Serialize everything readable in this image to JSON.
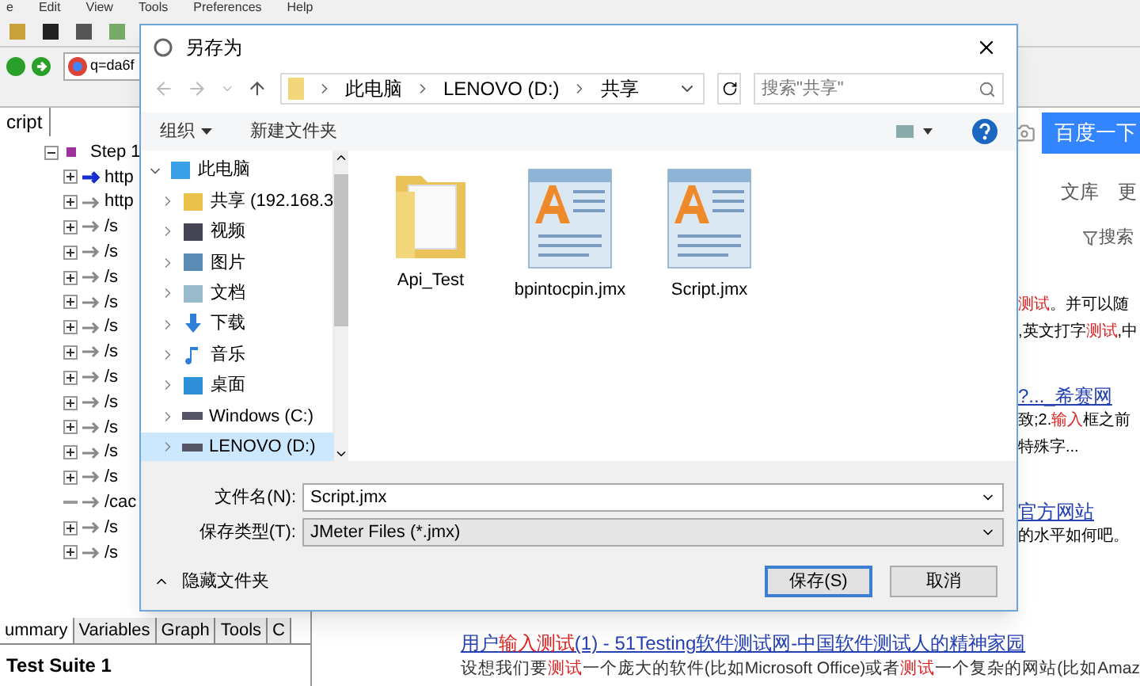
{
  "app": {
    "menu": [
      "e",
      "Edit",
      "View",
      "Tools",
      "Preferences",
      "Help"
    ],
    "address": "q=da6f",
    "script_tab": "cript",
    "tree": [
      {
        "label": "Step 1",
        "expanded": true,
        "children": [
          {
            "label": "http",
            "current": true,
            "expandable": true
          },
          {
            "label": "http",
            "current": false,
            "expandable": true
          },
          {
            "label": "/s",
            "current": false,
            "expandable": true
          },
          {
            "label": "/s",
            "current": false,
            "expandable": true
          },
          {
            "label": "/s",
            "current": false,
            "expandable": true
          },
          {
            "label": "/s",
            "current": false,
            "expandable": true
          },
          {
            "label": "/s",
            "current": false,
            "expandable": true
          },
          {
            "label": "/s",
            "current": false,
            "expandable": true
          },
          {
            "label": "/s",
            "current": false,
            "expandable": true
          },
          {
            "label": "/s",
            "current": false,
            "expandable": true
          },
          {
            "label": "/s",
            "current": false,
            "expandable": true
          },
          {
            "label": "/s",
            "current": false,
            "expandable": true
          },
          {
            "label": "/s",
            "current": false,
            "expandable": true
          },
          {
            "label": "/cac",
            "current": false,
            "expandable": false
          },
          {
            "label": "/s",
            "current": false,
            "expandable": true
          },
          {
            "label": "/s",
            "current": false,
            "expandable": true
          }
        ]
      }
    ],
    "bottom_tabs": [
      {
        "label": "ummary",
        "selected": true
      },
      {
        "label": "Variables",
        "selected": false
      },
      {
        "label": "Graph",
        "selected": false
      },
      {
        "label": "Tools",
        "selected": false
      },
      {
        "label": "C",
        "selected": false
      }
    ],
    "suite": "Test Suite 1"
  },
  "browser": {
    "search_button": "百度一下",
    "nav": [
      "文库",
      "更"
    ],
    "filter": "搜索",
    "fragments": [
      [
        {
          "text": "测试",
          "hit": true
        },
        {
          "text": "。并可以随",
          "hit": false
        }
      ],
      [
        {
          "text": ",英文打字",
          "hit": false
        },
        {
          "text": "测试",
          "hit": true
        },
        {
          "text": ",中",
          "hit": false
        }
      ],
      [
        {
          "text": "?..._希赛网",
          "link": true
        }
      ],
      [
        {
          "text": "致;2.",
          "hit": false
        },
        {
          "text": "输入",
          "hit": true
        },
        {
          "text": "框之前",
          "hit": false
        }
      ],
      [
        {
          "text": "特殊字...",
          "hit": false
        }
      ],
      [
        {
          "text": "官方网站",
          "link": true
        }
      ],
      [
        {
          "text": "的水平如何吧。",
          "hit": false
        }
      ]
    ],
    "result": {
      "title": [
        {
          "text": "用户",
          "hit": false
        },
        {
          "text": "输入测试",
          "hit": true
        },
        {
          "text": "(1) - 51Testing软件测试网-中国软件测试人的精神家园",
          "hit": false
        }
      ],
      "snippet": [
        {
          "text": "设想我们要",
          "hit": false
        },
        {
          "text": "测试",
          "hit": true
        },
        {
          "text": "一个庞大的软件(比如Microsoft Office)或者",
          "hit": false
        },
        {
          "text": "测试",
          "hit": true
        },
        {
          "text": "一个复杂的网站(比如Amaz",
          "hit": false
        }
      ]
    }
  },
  "dialog": {
    "title": "另存为",
    "breadcrumb": [
      "此电脑",
      "LENOVO (D:)",
      "共享"
    ],
    "search": {
      "placeholder": "搜索\"共享\""
    },
    "toolbar": {
      "organize": "组织",
      "new_folder": "新建文件夹"
    },
    "nav": [
      {
        "label": "此电脑",
        "kind": "pc",
        "expanded": true,
        "selected": false,
        "top": true
      },
      {
        "label": "共享 (192.168.3",
        "kind": "share",
        "expanded": false,
        "selected": false,
        "top": false
      },
      {
        "label": "视频",
        "kind": "video",
        "expanded": false,
        "selected": false,
        "top": false
      },
      {
        "label": "图片",
        "kind": "picture",
        "expanded": false,
        "selected": false,
        "top": false
      },
      {
        "label": "文档",
        "kind": "document",
        "expanded": false,
        "selected": false,
        "top": false
      },
      {
        "label": "下载",
        "kind": "download",
        "expanded": false,
        "selected": false,
        "top": false
      },
      {
        "label": "音乐",
        "kind": "music",
        "expanded": false,
        "selected": false,
        "top": false
      },
      {
        "label": "桌面",
        "kind": "desktop",
        "expanded": false,
        "selected": false,
        "top": false
      },
      {
        "label": "Windows (C:)",
        "kind": "drive",
        "expanded": false,
        "selected": false,
        "top": false
      },
      {
        "label": "LENOVO (D:)",
        "kind": "drive",
        "expanded": false,
        "selected": true,
        "top": false
      }
    ],
    "files": [
      {
        "name": "Api_Test",
        "kind": "folder"
      },
      {
        "name": "bpintocpin.jmx",
        "kind": "doc"
      },
      {
        "name": "Script.jmx",
        "kind": "doc"
      }
    ],
    "filename_label": "文件名(N):",
    "filename": "Script.jmx",
    "type_label": "保存类型(T):",
    "type": "JMeter Files (*.jmx)",
    "hide_folders": "隐藏文件夹",
    "save": "保存(S)",
    "cancel": "取消"
  }
}
